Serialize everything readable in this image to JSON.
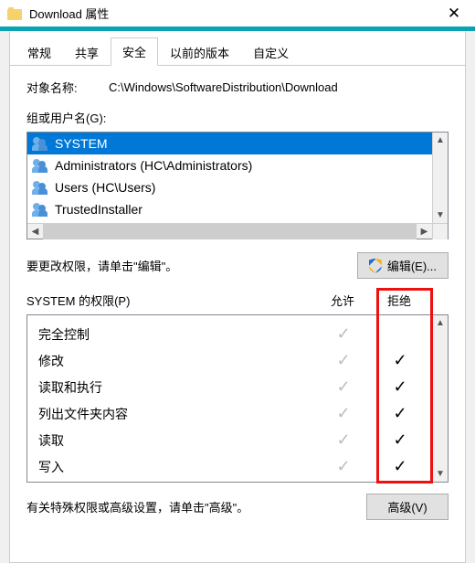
{
  "titlebar": {
    "title": "Download 属性"
  },
  "tabs": [
    {
      "label": "常规",
      "active": false
    },
    {
      "label": "共享",
      "active": false
    },
    {
      "label": "安全",
      "active": true
    },
    {
      "label": "以前的版本",
      "active": false
    },
    {
      "label": "自定义",
      "active": false
    }
  ],
  "object": {
    "label": "对象名称:",
    "value": "C:\\Windows\\SoftwareDistribution\\Download"
  },
  "groups": {
    "label": "组或用户名(G):",
    "items": [
      {
        "text": "SYSTEM",
        "selected": true
      },
      {
        "text": "Administrators (HC\\Administrators)",
        "selected": false
      },
      {
        "text": "Users (HC\\Users)",
        "selected": false
      },
      {
        "text": "TrustedInstaller",
        "selected": false
      }
    ]
  },
  "edit": {
    "hint": "要更改权限，请单击\"编辑\"。",
    "button": "编辑(E)..."
  },
  "perm": {
    "header_label": "SYSTEM 的权限(P)",
    "col_allow": "允许",
    "col_deny": "拒绝",
    "rows": [
      {
        "name": "完全控制",
        "allow": "dim",
        "deny": "none"
      },
      {
        "name": "修改",
        "allow": "dim",
        "deny": "check"
      },
      {
        "name": "读取和执行",
        "allow": "dim",
        "deny": "check"
      },
      {
        "name": "列出文件夹内容",
        "allow": "dim",
        "deny": "check"
      },
      {
        "name": "读取",
        "allow": "dim",
        "deny": "check"
      },
      {
        "name": "写入",
        "allow": "dim",
        "deny": "check"
      }
    ]
  },
  "advanced": {
    "hint": "有关特殊权限或高级设置，请单击\"高级\"。",
    "button": "高级(V)"
  }
}
